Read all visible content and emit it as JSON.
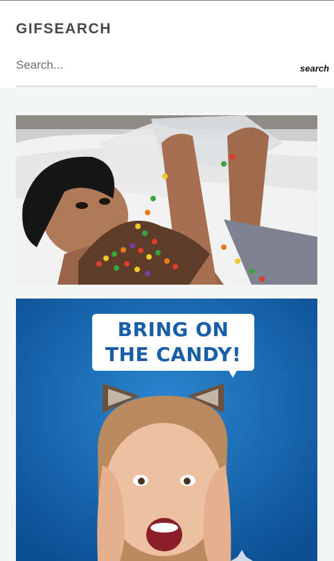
{
  "header": {
    "title": "GIFSEARCH",
    "search_placeholder": "Search...",
    "search_button_label": "search"
  },
  "results": [
    {
      "name": "gif-candy-bathtub",
      "caption": ""
    },
    {
      "name": "gif-bring-on-the-candy",
      "caption_line1": "BRING ON",
      "caption_line2": "THE CANDY!"
    }
  ],
  "colors": {
    "title": "#4a4848",
    "results_background": "#f4f6f5",
    "caption_text": "#1a5ea8",
    "caption_background": "#ffffff"
  }
}
